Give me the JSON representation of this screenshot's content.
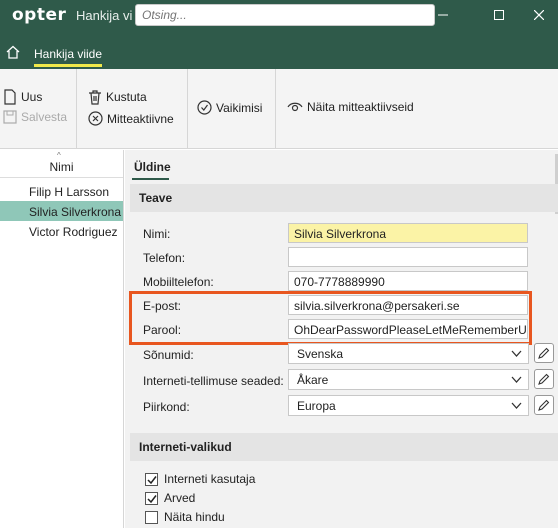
{
  "window": {
    "logo": "opter",
    "title": "Hankija vi",
    "search_placeholder": "Otsing..."
  },
  "tabs": {
    "active_label": "Hankija viide"
  },
  "toolbar": {
    "new_label": "Uus",
    "save_label": "Salvesta",
    "delete_label": "Kustuta",
    "inactive_label": "Mitteaktiivne",
    "default_label": "Vaikimisi",
    "show_inactive_label": "Näita mitteaktiivseid"
  },
  "list": {
    "header": "Nimi",
    "items": [
      {
        "name": "Filip H Larsson"
      },
      {
        "name": "Silvia Silverkrona"
      },
      {
        "name": "Victor Rodriguez"
      }
    ]
  },
  "detail": {
    "tab_label": "Üldine",
    "section_info": "Teave",
    "name_label": "Nimi:",
    "name_value": "Silvia Silverkrona",
    "phone_label": "Telefon:",
    "phone_value": "",
    "mobile_label": "Mobiiltelefon:",
    "mobile_value": "070-7778889990",
    "email_label": "E-post:",
    "email_value": "silvia.silverkrona@persakeri.se",
    "password_label": "Parool:",
    "password_value": "OhDearPasswordPleaseLetMeRememberU!",
    "phrases_label": "Sõnumid:",
    "phrases_value": "Svenska",
    "order_settings_label": "Interneti-tellimuse seaded:",
    "order_settings_value": "Åkare",
    "region_label": "Piirkond:",
    "region_value": "Europa",
    "section_internet": "Interneti-valikud",
    "internet_user_label": "Interneti kasutaja",
    "internet_user_checked": true,
    "invoices_label": "Arved",
    "invoices_checked": true,
    "show_price_label": "Näita hindu",
    "show_price_checked": false
  },
  "colors": {
    "brand": "#2f5a4a",
    "tab_underline": "#f0e84a",
    "selection": "#8fc7b8",
    "highlight_box": "#e8561f",
    "name_field": "#fbf3a6"
  }
}
